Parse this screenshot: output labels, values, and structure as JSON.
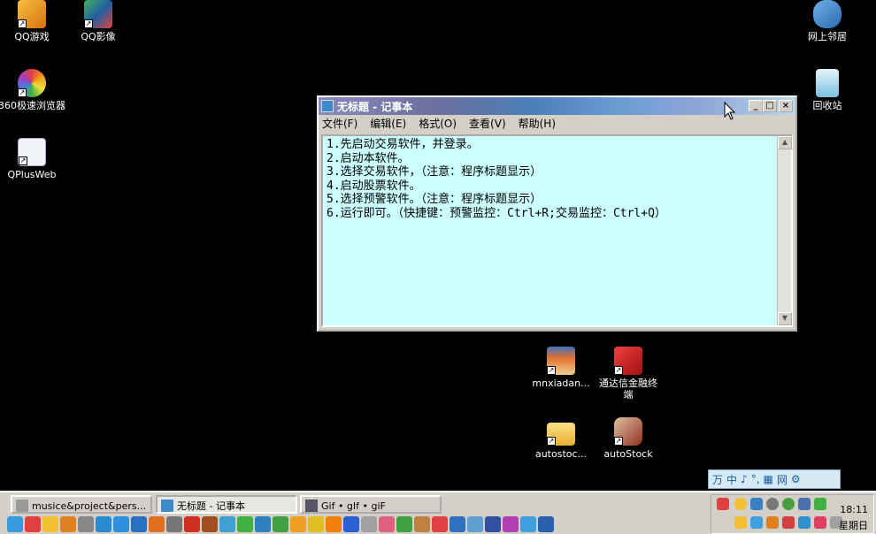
{
  "desktop_icons": [
    {
      "label": "QQ游戏",
      "icon": "qq-game-icon",
      "color": "#e8a020"
    },
    {
      "label": "QQ影像",
      "icon": "qq-image-icon",
      "color": "#3a9a50"
    },
    {
      "label": "360极速浏览器",
      "icon": "360-browser-icon",
      "color": "#e04040"
    },
    {
      "label": "QPlusWeb",
      "icon": "ie-web-icon",
      "color": "#4a90d0"
    },
    {
      "label": "网上邻居",
      "icon": "network-icon",
      "color": "#4a90d0"
    },
    {
      "label": "回收站",
      "icon": "recycle-bin-icon",
      "color": "#5ab0e0"
    },
    {
      "label": "mnxiadan...",
      "icon": "house-icon",
      "color": "#d86a30"
    },
    {
      "label": "通达信金融终端",
      "icon": "tdx-icon",
      "color": "#c03030"
    },
    {
      "label": "autostoc...",
      "icon": "folder-icon",
      "color": "#f0c040"
    },
    {
      "label": "autoStock",
      "icon": "autostock-icon",
      "color": "#a04030"
    }
  ],
  "notepad": {
    "title": "无标题 - 记事本",
    "menu": [
      "文件(F)",
      "编辑(E)",
      "格式(O)",
      "查看(V)",
      "帮助(H)"
    ],
    "lines": [
      "1.先启动交易软件，并登录。",
      "2.启动本软件。",
      "3.选择交易软件，（注意：程序标题显示）",
      "4.启动股票软件。",
      "5.选择预警软件。（注意：程序标题显示）",
      "6.运行即可。（快捷键：预警监控：Ctrl+R;交易监控：Ctrl+Q）"
    ]
  },
  "langbar": {
    "items": [
      "万",
      "中",
      "♪",
      "°,",
      "▦",
      "网",
      "⚙"
    ]
  },
  "taskbar": {
    "buttons": [
      {
        "label": "musice&project&pers...",
        "active": false
      },
      {
        "label": "无标题 - 记事本",
        "active": true
      },
      {
        "label": "Gif • gIf • giF",
        "active": false
      }
    ],
    "clock_time": "18:11",
    "clock_day": "星期日"
  },
  "colors": {
    "desktop": "#000000",
    "notepad_bg": "#ccffff",
    "taskbar": "#d4d0c8"
  }
}
